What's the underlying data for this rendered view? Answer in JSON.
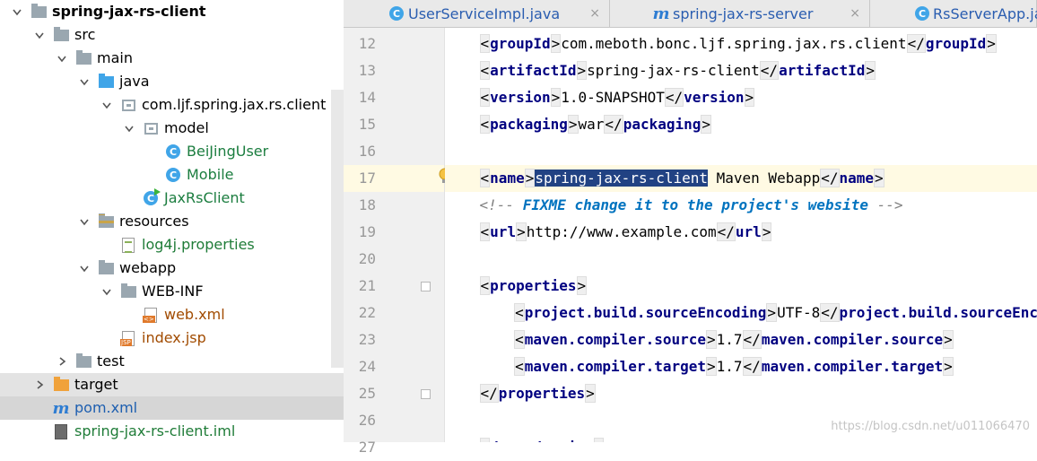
{
  "project_tree": {
    "items": [
      {
        "label": "spring-jax-rs-client",
        "level": 0,
        "icon": "module-folder-icon",
        "arrow": "down",
        "style": "bold"
      },
      {
        "label": "src",
        "level": 1,
        "icon": "folder-icon",
        "arrow": "down"
      },
      {
        "label": "main",
        "level": 2,
        "icon": "folder-icon",
        "arrow": "down"
      },
      {
        "label": "java",
        "level": 3,
        "icon": "source-folder-icon",
        "arrow": "down"
      },
      {
        "label": "com.ljf.spring.jax.rs.client",
        "level": 4,
        "icon": "package-icon",
        "arrow": "down"
      },
      {
        "label": "model",
        "level": 5,
        "icon": "package-icon",
        "arrow": "down"
      },
      {
        "label": "BeiJingUser",
        "level": 6,
        "icon": "class-icon",
        "arrow": "none",
        "style": "teal"
      },
      {
        "label": "Mobile",
        "level": 6,
        "icon": "class-icon",
        "arrow": "none",
        "style": "teal"
      },
      {
        "label": "JaxRsClient",
        "level": 5,
        "icon": "runnable-class-icon",
        "arrow": "none",
        "style": "teal"
      },
      {
        "label": "resources",
        "level": 3,
        "icon": "resources-folder-icon",
        "arrow": "down"
      },
      {
        "label": "log4j.properties",
        "level": 4,
        "icon": "properties-file-icon",
        "arrow": "none",
        "style": "green"
      },
      {
        "label": "webapp",
        "level": 3,
        "icon": "folder-icon",
        "arrow": "down"
      },
      {
        "label": "WEB-INF",
        "level": 4,
        "icon": "folder-icon",
        "arrow": "down"
      },
      {
        "label": "web.xml",
        "level": 5,
        "icon": "xml-file-icon",
        "arrow": "none",
        "style": "orange"
      },
      {
        "label": "index.jsp",
        "level": 4,
        "icon": "jsp-file-icon",
        "arrow": "none",
        "style": "orange"
      },
      {
        "label": "test",
        "level": 2,
        "icon": "folder-icon",
        "arrow": "right"
      },
      {
        "label": "target",
        "level": 1,
        "icon": "excluded-folder-icon",
        "arrow": "right",
        "highlight": "hl"
      },
      {
        "label": "pom.xml",
        "level": 1,
        "icon": "maven-icon",
        "arrow": "none",
        "highlight": "sel",
        "style": "blue"
      },
      {
        "label": "spring-jax-rs-client.iml",
        "level": 1,
        "icon": "iml-file-icon",
        "arrow": "none",
        "style": "green"
      }
    ]
  },
  "tabs": [
    {
      "label": "UserServiceImpl.java",
      "icon": "class-icon",
      "close": "×"
    },
    {
      "label": "spring-jax-rs-server",
      "icon": "maven-icon",
      "close": "×"
    },
    {
      "label": "RsServerApp.java",
      "icon": "class-icon",
      "close": ""
    }
  ],
  "editor": {
    "lines": [
      {
        "n": "12",
        "tokens": [
          {
            "t": "    "
          },
          {
            "t": "<",
            "c": "br"
          },
          {
            "t": "groupId",
            "c": "tg"
          },
          {
            "t": ">",
            "c": "br"
          },
          {
            "t": "com.meboth.bonc.ljf.spring.jax.rs.client"
          },
          {
            "t": "</",
            "c": "br"
          },
          {
            "t": "groupId",
            "c": "tg"
          },
          {
            "t": ">",
            "c": "br"
          }
        ]
      },
      {
        "n": "13",
        "tokens": [
          {
            "t": "    "
          },
          {
            "t": "<",
            "c": "br"
          },
          {
            "t": "artifactId",
            "c": "tg"
          },
          {
            "t": ">",
            "c": "br"
          },
          {
            "t": "spring-jax-rs-client"
          },
          {
            "t": "</",
            "c": "br"
          },
          {
            "t": "artifactId",
            "c": "tg"
          },
          {
            "t": ">",
            "c": "br"
          }
        ]
      },
      {
        "n": "14",
        "tokens": [
          {
            "t": "    "
          },
          {
            "t": "<",
            "c": "br"
          },
          {
            "t": "version",
            "c": "tg"
          },
          {
            "t": ">",
            "c": "br"
          },
          {
            "t": "1.0-SNAPSHOT"
          },
          {
            "t": "</",
            "c": "br"
          },
          {
            "t": "version",
            "c": "tg"
          },
          {
            "t": ">",
            "c": "br"
          }
        ]
      },
      {
        "n": "15",
        "tokens": [
          {
            "t": "    "
          },
          {
            "t": "<",
            "c": "br"
          },
          {
            "t": "packaging",
            "c": "tg"
          },
          {
            "t": ">",
            "c": "br"
          },
          {
            "t": "war"
          },
          {
            "t": "</",
            "c": "br"
          },
          {
            "t": "packaging",
            "c": "tg"
          },
          {
            "t": ">",
            "c": "br"
          }
        ]
      },
      {
        "n": "16",
        "tokens": []
      },
      {
        "n": "17",
        "current": true,
        "tokens": [
          {
            "t": "    "
          },
          {
            "t": "<",
            "c": "br"
          },
          {
            "t": "name",
            "c": "tg"
          },
          {
            "t": ">",
            "c": "br"
          },
          {
            "t": "spring-jax-rs-client",
            "c": "selt"
          },
          {
            "t": " Maven Webapp"
          },
          {
            "t": "</",
            "c": "br"
          },
          {
            "t": "name",
            "c": "tg"
          },
          {
            "t": ">",
            "c": "br"
          }
        ]
      },
      {
        "n": "18",
        "tokens": [
          {
            "t": "    "
          },
          {
            "t": "<!-- ",
            "c": "cm"
          },
          {
            "t": "FIXME change it to the project's website",
            "c": "todo"
          },
          {
            "t": " -->",
            "c": "cm"
          }
        ]
      },
      {
        "n": "19",
        "tokens": [
          {
            "t": "    "
          },
          {
            "t": "<",
            "c": "br"
          },
          {
            "t": "url",
            "c": "tg"
          },
          {
            "t": ">",
            "c": "br"
          },
          {
            "t": "http://www.example.com"
          },
          {
            "t": "</",
            "c": "br"
          },
          {
            "t": "url",
            "c": "tg"
          },
          {
            "t": ">",
            "c": "br"
          }
        ]
      },
      {
        "n": "20",
        "tokens": []
      },
      {
        "n": "21",
        "tokens": [
          {
            "t": "    "
          },
          {
            "t": "<",
            "c": "br"
          },
          {
            "t": "properties",
            "c": "tg"
          },
          {
            "t": ">",
            "c": "br"
          }
        ]
      },
      {
        "n": "22",
        "tokens": [
          {
            "t": "        "
          },
          {
            "t": "<",
            "c": "br"
          },
          {
            "t": "project.build.sourceEncoding",
            "c": "tg"
          },
          {
            "t": ">",
            "c": "br"
          },
          {
            "t": "UTF-8"
          },
          {
            "t": "</",
            "c": "br"
          },
          {
            "t": "project.build.sourceEncoding",
            "c": "tg"
          },
          {
            "t": ">",
            "c": "br"
          }
        ]
      },
      {
        "n": "23",
        "tokens": [
          {
            "t": "        "
          },
          {
            "t": "<",
            "c": "br"
          },
          {
            "t": "maven.compiler.source",
            "c": "tg"
          },
          {
            "t": ">",
            "c": "br"
          },
          {
            "t": "1.7"
          },
          {
            "t": "</",
            "c": "br"
          },
          {
            "t": "maven.compiler.source",
            "c": "tg"
          },
          {
            "t": ">",
            "c": "br"
          }
        ]
      },
      {
        "n": "24",
        "tokens": [
          {
            "t": "        "
          },
          {
            "t": "<",
            "c": "br"
          },
          {
            "t": "maven.compiler.target",
            "c": "tg"
          },
          {
            "t": ">",
            "c": "br"
          },
          {
            "t": "1.7"
          },
          {
            "t": "</",
            "c": "br"
          },
          {
            "t": "maven.compiler.target",
            "c": "tg"
          },
          {
            "t": ">",
            "c": "br"
          }
        ]
      },
      {
        "n": "25",
        "tokens": [
          {
            "t": "    "
          },
          {
            "t": "</",
            "c": "br"
          },
          {
            "t": "properties",
            "c": "tg"
          },
          {
            "t": ">",
            "c": "br"
          }
        ]
      },
      {
        "n": "26",
        "tokens": []
      },
      {
        "n": "27",
        "tokens": [
          {
            "t": "    "
          },
          {
            "t": "<",
            "c": "br"
          },
          {
            "t": "dependencies",
            "c": "tg"
          },
          {
            "t": ">",
            "c": "br"
          }
        ]
      }
    ]
  },
  "watermark": "https://blog.csdn.net/u011066470",
  "colors": {
    "tag": "#000080",
    "selection": "#214283",
    "current_line": "#fffae3",
    "class_icon": "#40a5e8"
  }
}
